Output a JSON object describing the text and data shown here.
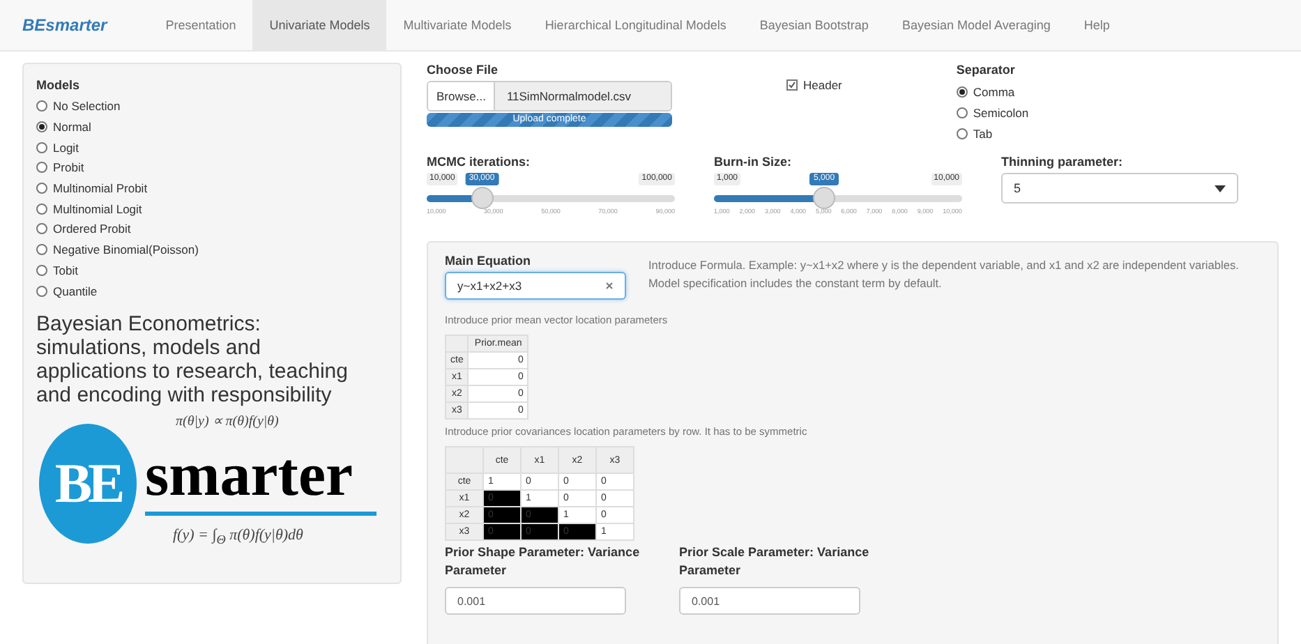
{
  "navbar": {
    "brand": "BEsmarter",
    "tabs": [
      {
        "label": "Presentation",
        "selected": false
      },
      {
        "label": "Univariate Models",
        "selected": true
      },
      {
        "label": "Multivariate Models",
        "selected": false
      },
      {
        "label": "Hierarchical Longitudinal Models",
        "selected": false
      },
      {
        "label": "Bayesian Bootstrap",
        "selected": false
      },
      {
        "label": "Bayesian Model Averaging",
        "selected": false
      },
      {
        "label": "Help",
        "selected": false
      }
    ]
  },
  "sidebar": {
    "title": "Models",
    "options": [
      {
        "label": "No Selection",
        "selected": false
      },
      {
        "label": "Normal",
        "selected": true
      },
      {
        "label": "Logit",
        "selected": false
      },
      {
        "label": "Probit",
        "selected": false
      },
      {
        "label": "Multinomial Probit",
        "selected": false
      },
      {
        "label": "Multinomial Logit",
        "selected": false
      },
      {
        "label": "Ordered Probit",
        "selected": false
      },
      {
        "label": "Negative Binomial(Poisson)",
        "selected": false
      },
      {
        "label": "Tobit",
        "selected": false
      },
      {
        "label": "Quantile",
        "selected": false
      }
    ],
    "headline": "Bayesian Econometrics: simulations, models and applications to research, teaching and encoding with responsibility",
    "logo": {
      "badge": "BE",
      "word": "smarter",
      "formula_top": "π(θ|y) ∝ π(θ)f(y|θ)",
      "formula_bottom": "f(y) = ∫$_{Θ}$ π(θ)f(y|θ)dθ"
    }
  },
  "file": {
    "label": "Choose File",
    "button": "Browse...",
    "filename": "11SimNormalmodel.csv",
    "progress": "Upload complete",
    "level": 1
  },
  "header_checkbox": {
    "label": "Header",
    "checked": true
  },
  "separator": {
    "label": "Separator",
    "options": [
      {
        "label": "Comma",
        "selected": true
      },
      {
        "label": "Semicolon",
        "selected": false
      },
      {
        "label": "Tab",
        "selected": false
      }
    ]
  },
  "sliders": [
    {
      "label": "MCMC iterations:",
      "min": "10,000",
      "max": "100,000",
      "value": "30,000",
      "level": 0.222,
      "ticks": [
        "10,000",
        "30,000",
        "50,000",
        "70,000",
        "90,000"
      ]
    },
    {
      "label": "Burn-in Size:",
      "min": "1,000",
      "max": "10,000",
      "value": "5,000",
      "level": 0.444,
      "ticks": [
        "1,000",
        "2,000",
        "3,000",
        "4,000",
        "5,000",
        "6,000",
        "7,000",
        "8,000",
        "9,000",
        "10,000"
      ]
    }
  ],
  "thinning": {
    "label": "Thinning parameter:",
    "value": "5"
  },
  "equation": {
    "label": "Main Equation",
    "value": "y~x1+x2+x3",
    "help": "Introduce Formula. Example: y~x1+x2 where y is the dependent variable, and x1 and x2 are independent variables. Model specification includes the constant term by default."
  },
  "mean_table": {
    "caption": "Introduce prior mean vector location parameters",
    "columns": [
      "Prior.mean"
    ],
    "rows": [
      {
        "label": "cte",
        "cells": [
          {
            "value": "0",
            "locked": false
          }
        ]
      },
      {
        "label": "x1",
        "cells": [
          {
            "value": "0",
            "locked": false
          }
        ]
      },
      {
        "label": "x2",
        "cells": [
          {
            "value": "0",
            "locked": false
          }
        ]
      },
      {
        "label": "x3",
        "cells": [
          {
            "value": "0",
            "locked": false
          }
        ]
      }
    ]
  },
  "cov_table": {
    "caption": "Introduce prior covariances location parameters by row. It has to be symmetric",
    "columns": [
      "cte",
      "x1",
      "x2",
      "x3"
    ],
    "rows": [
      {
        "label": "cte",
        "cells": [
          {
            "value": "1",
            "locked": false
          },
          {
            "value": "0",
            "locked": false
          },
          {
            "value": "0",
            "locked": false
          },
          {
            "value": "0",
            "locked": false
          }
        ]
      },
      {
        "label": "x1",
        "cells": [
          {
            "value": "0",
            "locked": true
          },
          {
            "value": "1",
            "locked": false
          },
          {
            "value": "0",
            "locked": false
          },
          {
            "value": "0",
            "locked": false
          }
        ]
      },
      {
        "label": "x2",
        "cells": [
          {
            "value": "0",
            "locked": true
          },
          {
            "value": "0",
            "locked": true
          },
          {
            "value": "1",
            "locked": false
          },
          {
            "value": "0",
            "locked": false
          }
        ]
      },
      {
        "label": "x3",
        "cells": [
          {
            "value": "0",
            "locked": true
          },
          {
            "value": "0",
            "locked": true
          },
          {
            "value": "0",
            "locked": true
          },
          {
            "value": "1",
            "locked": false
          }
        ]
      }
    ]
  },
  "priors": [
    {
      "label": "Prior Shape Parameter: Variance Parameter",
      "value": "0.001"
    },
    {
      "label": "Prior Scale Parameter: Variance Parameter",
      "value": "0.001"
    }
  ]
}
